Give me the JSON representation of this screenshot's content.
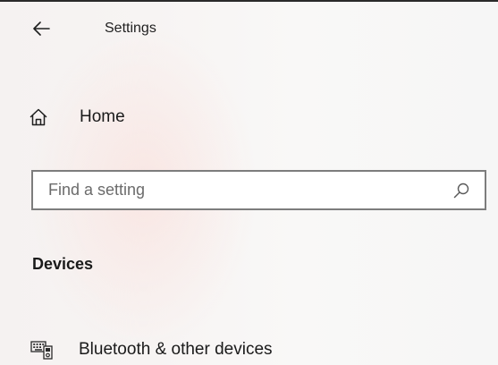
{
  "window": {
    "title": "Settings",
    "back_icon": "back-arrow-icon"
  },
  "nav": {
    "home": {
      "label": "Home",
      "icon": "home-icon"
    }
  },
  "search": {
    "placeholder": "Find a setting",
    "value": "",
    "icon": "search-icon"
  },
  "section": {
    "heading": "Devices",
    "items": [
      {
        "label": "Bluetooth & other devices",
        "icon": "devices-keyboard-icon"
      }
    ]
  },
  "colors": {
    "accent_tint": "#fae2de",
    "text": "#1a1a1a",
    "search_border": "#7d7d7d"
  }
}
